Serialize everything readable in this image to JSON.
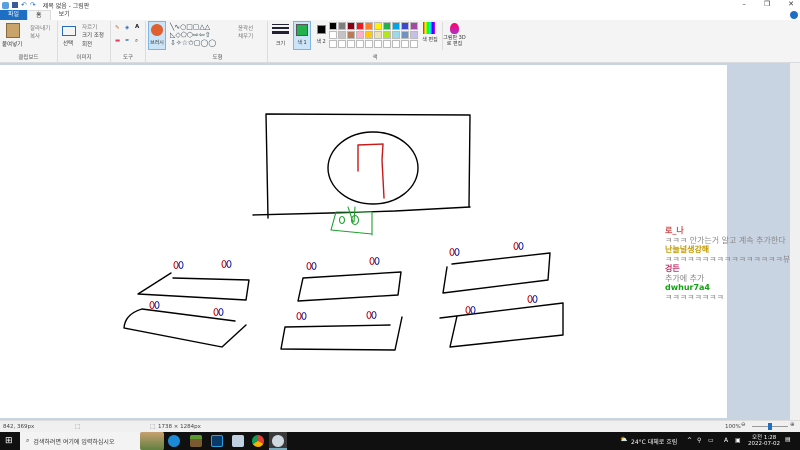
{
  "window": {
    "title": "제목 없음 - 그림판",
    "minimize": "–",
    "restore": "❐",
    "close": "✕"
  },
  "tabs": [
    {
      "label": "파일"
    },
    {
      "label": "홈"
    },
    {
      "label": "보기"
    }
  ],
  "ribbon": {
    "clipboard": {
      "paste": "붙여넣기",
      "cut": "잘라내기",
      "copy": "복사",
      "label": "클립보드"
    },
    "image": {
      "select": "선택",
      "crop": "자르기",
      "resize": "크기 조정",
      "rotate": "회전",
      "label": "이미지"
    },
    "tools": {
      "label": "도구"
    },
    "brushes": {
      "label": "브러시"
    },
    "shapes": {
      "outline": "윤곽선",
      "fill": "채우기",
      "label": "도형"
    },
    "size": {
      "label": "크기"
    },
    "color1": {
      "label": "색 1",
      "color": "#22b14c"
    },
    "color2": {
      "label": "색 2",
      "color": "#000000"
    },
    "edit_colors": "색 편집",
    "paint3d": "그림판 3D로 편집",
    "colors_label": "색",
    "palette": [
      "#000000",
      "#7f7f7f",
      "#880015",
      "#ed1c24",
      "#ff7f27",
      "#fff200",
      "#22b14c",
      "#00a2e8",
      "#3f48cc",
      "#a349a4",
      "#ffffff",
      "#c3c3c3",
      "#b97a57",
      "#ffaec9",
      "#ffc90e",
      "#efe4b0",
      "#b5e61d",
      "#99d9ea",
      "#7092be",
      "#c8bfe7"
    ]
  },
  "chat": [
    {
      "name": "로_나",
      "color": "#d04848",
      "message": "ㅋㅋㅋ 안가는거 알고 계속 추가한다"
    },
    {
      "name": "난늘널생강해",
      "color": "#c49a00",
      "message": "ㅋㅋㅋㅋㅋㅋㅋㅋㅋㅋㅋㅋㅋㅋㅋㅋ뷰"
    },
    {
      "name": "겅든",
      "color": "#c0306a",
      "message": "추가에 추가"
    },
    {
      "name": "dwhur7a4",
      "color": "#14a014",
      "message": "ㅋㅋㅋㅋㅋㅋㅋㅋ"
    }
  ],
  "status": {
    "cursor": "842, 369px",
    "selection": "",
    "canvas_size": "1738 × 1284px",
    "zoom": "100%",
    "zoom_fraction": 0.5
  },
  "taskbar": {
    "search_placeholder": "검색하려면 여기에 입력하십시오",
    "weather": "24°C 대체로 흐림",
    "time": "오전 1:28",
    "date": "2022-07-02",
    "ime": "A"
  }
}
